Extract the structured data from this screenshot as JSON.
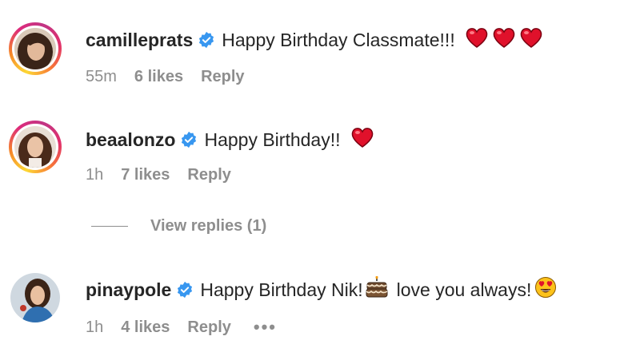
{
  "comments": [
    {
      "username": "camilleprats",
      "text": "Happy Birthday Classmate!!!",
      "emoji": [
        "red-heart",
        "red-heart",
        "red-heart"
      ],
      "time": "55m",
      "likes": "6 likes",
      "reply": "Reply"
    },
    {
      "username": "beaalonzo",
      "text": "Happy Birthday!!",
      "emoji": [
        "red-heart"
      ],
      "time": "1h",
      "likes": "7 likes",
      "reply": "Reply"
    },
    {
      "username": "pinaypole",
      "text_before": "Happy Birthday Nik!",
      "text_after": "love you always!",
      "emoji": [
        "birthday-cake",
        "heart-eyes-face"
      ],
      "time": "1h",
      "likes": "4 likes",
      "reply": "Reply",
      "more": "•••"
    }
  ],
  "view_replies": "View replies (1)",
  "colors": {
    "text": "#262626",
    "muted": "#8e8e8e",
    "verified": "#3897f0",
    "heart": "#e0112b"
  }
}
